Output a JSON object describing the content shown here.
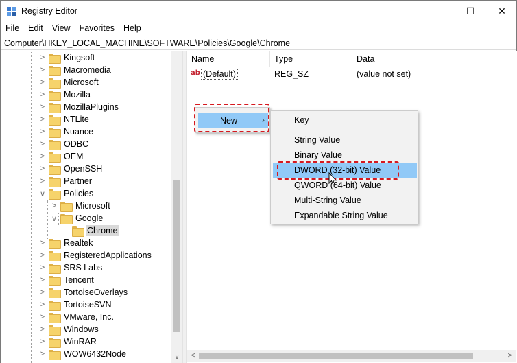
{
  "window": {
    "title": "Registry Editor",
    "controls": {
      "minimize": "—",
      "maximize": "☐",
      "close": "✕"
    }
  },
  "menubar": [
    "File",
    "Edit",
    "View",
    "Favorites",
    "Help"
  ],
  "address": "Computer\\HKEY_LOCAL_MACHINE\\SOFTWARE\\Policies\\Google\\Chrome",
  "tree": {
    "items": [
      {
        "label": "Kingsoft",
        "level": 0,
        "expanded": false
      },
      {
        "label": "Macromedia",
        "level": 0,
        "expanded": false
      },
      {
        "label": "Microsoft",
        "level": 0,
        "expanded": false
      },
      {
        "label": "Mozilla",
        "level": 0,
        "expanded": false
      },
      {
        "label": "MozillaPlugins",
        "level": 0,
        "expanded": false
      },
      {
        "label": "NTLite",
        "level": 0,
        "expanded": false
      },
      {
        "label": "Nuance",
        "level": 0,
        "expanded": false
      },
      {
        "label": "ODBC",
        "level": 0,
        "expanded": false
      },
      {
        "label": "OEM",
        "level": 0,
        "expanded": false
      },
      {
        "label": "OpenSSH",
        "level": 0,
        "expanded": false
      },
      {
        "label": "Partner",
        "level": 0,
        "expanded": false
      },
      {
        "label": "Policies",
        "level": 0,
        "expanded": true
      },
      {
        "label": "Microsoft",
        "level": 1,
        "expanded": false
      },
      {
        "label": "Google",
        "level": 1,
        "expanded": true
      },
      {
        "label": "Chrome",
        "level": 2,
        "expanded": null,
        "selected": true
      },
      {
        "label": "Realtek",
        "level": 0,
        "expanded": false
      },
      {
        "label": "RegisteredApplications",
        "level": 0,
        "expanded": false
      },
      {
        "label": "SRS Labs",
        "level": 0,
        "expanded": false
      },
      {
        "label": "Tencent",
        "level": 0,
        "expanded": false
      },
      {
        "label": "TortoiseOverlays",
        "level": 0,
        "expanded": false
      },
      {
        "label": "TortoiseSVN",
        "level": 0,
        "expanded": false
      },
      {
        "label": "VMware, Inc.",
        "level": 0,
        "expanded": false
      },
      {
        "label": "Windows",
        "level": 0,
        "expanded": false
      },
      {
        "label": "WinRAR",
        "level": 0,
        "expanded": false
      },
      {
        "label": "WOW6432Node",
        "level": 0,
        "expanded": false
      }
    ]
  },
  "list": {
    "columns": [
      "Name",
      "Type",
      "Data"
    ],
    "rows": [
      {
        "icon": "ab",
        "name": "(Default)",
        "type": "REG_SZ",
        "data": "(value not set)"
      }
    ]
  },
  "context_menu": {
    "item": "New",
    "arrow": "›"
  },
  "submenu": {
    "items": [
      "Key",
      "String Value",
      "Binary Value",
      "DWORD (32-bit) Value",
      "QWORD (64-bit) Value",
      "Multi-String Value",
      "Expandable String Value"
    ],
    "hovered": "DWORD (32-bit) Value"
  },
  "scroll_glyphs": {
    "down": "∨",
    "left": "<",
    "right": ">"
  },
  "colors": {
    "accent_highlight": "#91c9f7",
    "annotation_red": "#d6191f",
    "folder_yellow": "#f6d36b"
  }
}
